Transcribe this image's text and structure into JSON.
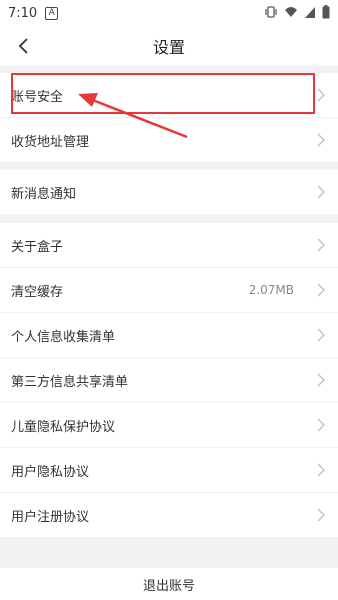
{
  "status": {
    "time": "7:10",
    "icon_letter": "A"
  },
  "header": {
    "title": "设置",
    "back_icon": "chevron-left-icon"
  },
  "sections": [
    {
      "items": [
        {
          "label": "账号安全"
        },
        {
          "label": "收货地址管理"
        }
      ]
    },
    {
      "items": [
        {
          "label": "新消息通知"
        }
      ]
    },
    {
      "items": [
        {
          "label": "关于盒子"
        },
        {
          "label": "清空缓存",
          "value": "2.07MB"
        },
        {
          "label": "个人信息收集清单"
        },
        {
          "label": "第三方信息共享清单"
        },
        {
          "label": "儿童隐私保护协议"
        },
        {
          "label": "用户隐私协议"
        },
        {
          "label": "用户注册协议"
        }
      ]
    }
  ],
  "footer": {
    "logout_label": "退出账号"
  },
  "colors": {
    "annotation": "#e53935",
    "chevron": "#c4c4c4"
  }
}
